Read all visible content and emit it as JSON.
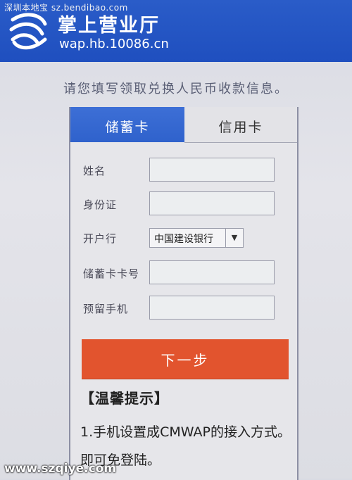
{
  "watermarks": {
    "top": "深圳本地宝 sz.bendibao.com",
    "bottom": "www.szqiye.com"
  },
  "header": {
    "title": "掌上营业厅",
    "url": "wap.hb.10086.cn",
    "logo_icon": "china-mobile-logo-icon",
    "background_color": "#2458c6"
  },
  "instruction": "请您填写领取兑换人民币收款信息。",
  "tabs": [
    {
      "label": "储蓄卡",
      "active": true
    },
    {
      "label": "信用卡",
      "active": false
    }
  ],
  "form": {
    "fields": [
      {
        "label": "姓名",
        "value": ""
      },
      {
        "label": "身份证",
        "value": ""
      },
      {
        "label": "开户行",
        "selected": "中国建设银行"
      },
      {
        "label": "储蓄卡卡号",
        "value": ""
      },
      {
        "label": "预留手机",
        "value": ""
      }
    ]
  },
  "next_button": {
    "label": "下一步",
    "color": "#e2542e"
  },
  "tips": {
    "title": "【温馨提示】",
    "body": "1.手机设置成CMWAP的接入方式。即可免登陆。"
  }
}
